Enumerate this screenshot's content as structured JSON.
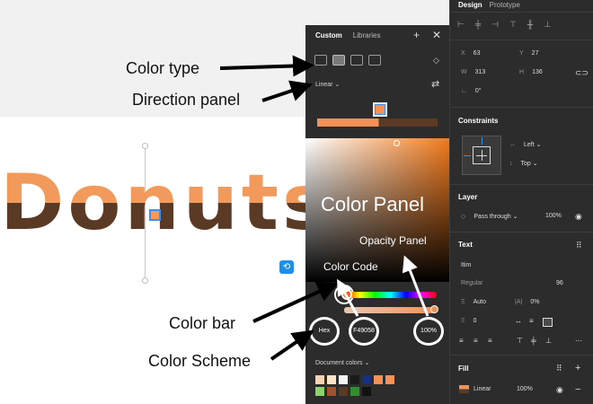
{
  "canvas": {
    "word": "Donuts"
  },
  "annotations": {
    "color_type": "Color type",
    "direction_panel": "Direction panel",
    "color_panel": "Color Panel",
    "opacity_panel": "Opacity Panel",
    "color_code": "Color Code",
    "color_bar": "Color bar",
    "color_scheme": "Color Scheme"
  },
  "picker": {
    "tabs": [
      "Custom",
      "Libraries"
    ],
    "add_icon": "plus-icon",
    "close_icon": "close-icon",
    "gradient_type": "Linear",
    "scheme": "Hex",
    "hex_value": "F49058",
    "opacity": "100%",
    "document_colors_label": "Document colors",
    "selected_color": "#F49058",
    "document_colors": [
      "#f7d2b0",
      "#fbe4c8",
      "#f4f4f4",
      "#1a1a1a",
      "#173080",
      "#f49058",
      "#f49058",
      "#8bd46b",
      "#a0522d",
      "#5a3a24",
      "#2f8f2f",
      "#111111"
    ]
  },
  "sidebar": {
    "tabs": [
      "Design",
      "Prototype"
    ],
    "x_label": "X",
    "x_value": "63",
    "y_label": "Y",
    "y_value": "27",
    "w_label": "W",
    "w_value": "313",
    "h_label": "H",
    "h_value": "136",
    "rotation": "0°",
    "constraints_heading": "Constraints",
    "constraint_horizontal": "Left",
    "constraint_vertical": "Top",
    "layer_heading": "Layer",
    "blend_mode": "Pass through",
    "layer_opacity": "100%",
    "text_heading": "Text",
    "font_name": "Itim",
    "font_style": "Regular",
    "font_size": "96",
    "line_height": "Auto",
    "letter_spacing": "0%",
    "paragraph_spacing": "0",
    "fill_heading": "Fill",
    "fill_type": "Linear",
    "fill_opacity": "100%"
  }
}
